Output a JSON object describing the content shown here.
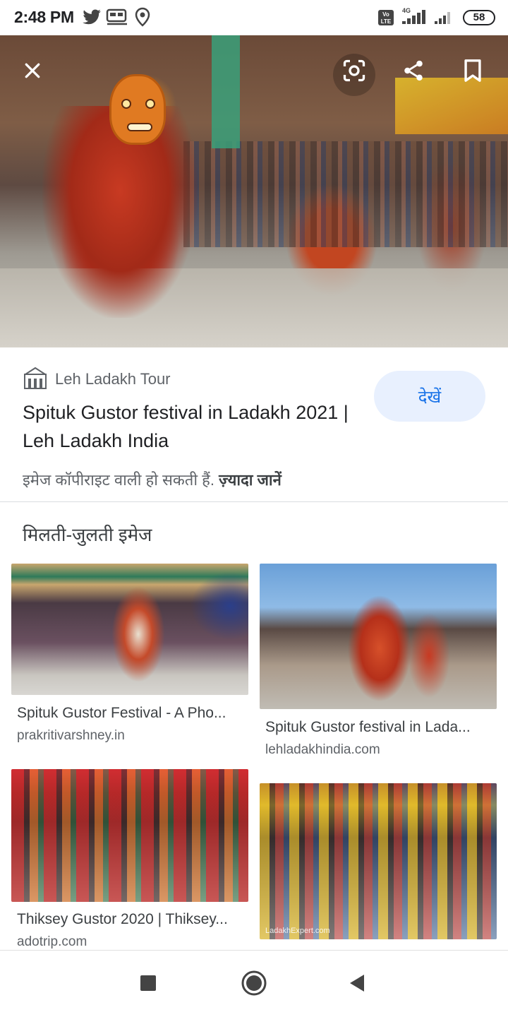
{
  "status_bar": {
    "time": "2:48 PM",
    "battery": "58",
    "icons": [
      "twitter-icon",
      "train-icon",
      "location-icon",
      "volte-icon",
      "signal-4g-icon",
      "signal-icon",
      "battery-icon"
    ],
    "network_label": "4G",
    "volte_label": "Vo LTE"
  },
  "hero": {
    "buttons": [
      "close-icon",
      "lens-icon",
      "share-icon",
      "bookmark-icon"
    ]
  },
  "source": {
    "site_name": "Leh Ladakh Tour",
    "title": "Spituk Gustor festival in Ladakh 2021 | Leh Ladakh India",
    "visit_label": "देखें",
    "copyright_text": "इमेज कॉपीराइट वाली हो सकती हैं.",
    "learn_more": "ज़्यादा जानें"
  },
  "related": {
    "heading": "मिलती-जुलती इमेज",
    "items": [
      {
        "title": "Spituk Gustor Festival - A Pho...",
        "site": "prakritivarshney.in"
      },
      {
        "title": "Spituk Gustor festival in Lada...",
        "site": "lehladakhindia.com"
      },
      {
        "title": "Thiksey Gustor 2020 | Thiksey...",
        "site": "adotrip.com"
      },
      {
        "title": "",
        "site": ""
      }
    ],
    "watermark": "LadakhExpert.com"
  },
  "navbar": {
    "buttons": [
      "recents-icon",
      "home-icon",
      "back-icon"
    ]
  },
  "colors": {
    "accent": "#1a73e8",
    "visit_button_bg": "#e8f0fe",
    "text_primary": "#202124",
    "text_secondary": "#5f6368"
  }
}
